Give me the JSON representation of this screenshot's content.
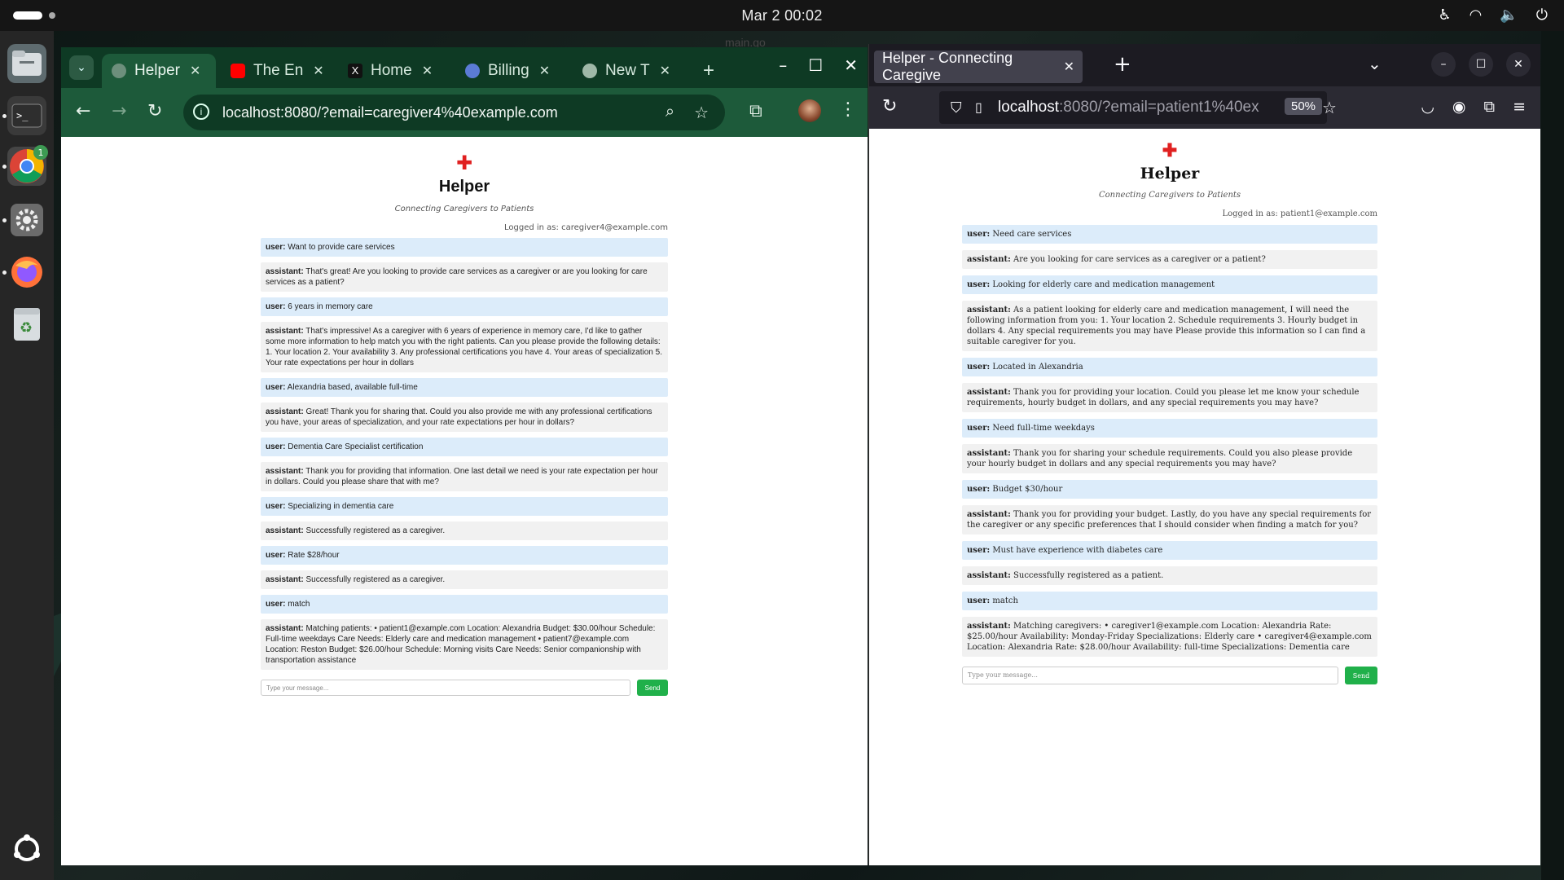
{
  "topbar": {
    "clock": "Mar 2  00:02"
  },
  "behind_window_title": "main.go",
  "chrome": {
    "tabs": [
      {
        "label": "Helper",
        "icon": "globe-icon",
        "active": true
      },
      {
        "label": "The En",
        "icon": "youtube-icon"
      },
      {
        "label": "Home",
        "icon": "x-icon"
      },
      {
        "label": "Billing",
        "icon": "openai-icon"
      },
      {
        "label": "New T",
        "icon": "chrome-icon"
      }
    ],
    "url": "localhost:8080/?email=caregiver4%40example.com"
  },
  "chrome_app": {
    "title": "Helper",
    "subtitle": "Connecting Caregivers to Patients",
    "login": "Logged in as: caregiver4@example.com",
    "messages": [
      {
        "role": "user",
        "label": "user:",
        "text": " Want to provide care services"
      },
      {
        "role": "assistant",
        "label": "assistant:",
        "text": " That's great! Are you looking to provide care services as a caregiver or are you looking for care services as a patient?"
      },
      {
        "role": "user",
        "label": "user:",
        "text": " 6 years in memory care"
      },
      {
        "role": "assistant",
        "label": "assistant:",
        "text": " That's impressive! As a caregiver with 6 years of experience in memory care, I'd like to gather some more information to help match you with the right patients. Can you please provide the following details: 1. Your location 2. Your availability 3. Any professional certifications you have 4. Your areas of specialization 5. Your rate expectations per hour in dollars"
      },
      {
        "role": "user",
        "label": "user:",
        "text": " Alexandria based, available full-time"
      },
      {
        "role": "assistant",
        "label": "assistant:",
        "text": " Great! Thank you for sharing that. Could you also provide me with any professional certifications you have, your areas of specialization, and your rate expectations per hour in dollars?"
      },
      {
        "role": "user",
        "label": "user:",
        "text": " Dementia Care Specialist certification"
      },
      {
        "role": "assistant",
        "label": "assistant:",
        "text": " Thank you for providing that information. One last detail we need is your rate expectation per hour in dollars. Could you please share that with me?"
      },
      {
        "role": "user",
        "label": "user:",
        "text": " Specializing in dementia care"
      },
      {
        "role": "assistant",
        "label": "assistant:",
        "text": " Successfully registered as a caregiver."
      },
      {
        "role": "user",
        "label": "user:",
        "text": " Rate $28/hour"
      },
      {
        "role": "assistant",
        "label": "assistant:",
        "text": " Successfully registered as a caregiver."
      },
      {
        "role": "user",
        "label": "user:",
        "text": " match"
      },
      {
        "role": "assistant",
        "label": "assistant:",
        "text": " Matching patients: • patient1@example.com Location: Alexandria Budget: $30.00/hour Schedule: Full-time weekdays Care Needs: Elderly care and medication management • patient7@example.com Location: Reston Budget: $26.00/hour Schedule: Morning visits Care Needs: Senior companionship with transportation assistance"
      }
    ],
    "input_placeholder": "Type your message...",
    "send_label": "Send"
  },
  "firefox": {
    "tab_title": "Helper - Connecting Caregive",
    "url_host": "localhost",
    "url_rest": ":8080/?email=patient1%40ex",
    "zoom": "50%"
  },
  "firefox_app": {
    "title": "Helper",
    "subtitle": "Connecting Caregivers to Patients",
    "login": "Logged in as: patient1@example.com",
    "messages": [
      {
        "role": "user",
        "label": "user:",
        "text": " Need care services"
      },
      {
        "role": "assistant",
        "label": "assistant:",
        "text": " Are you looking for care services as a caregiver or a patient?"
      },
      {
        "role": "user",
        "label": "user:",
        "text": " Looking for elderly care and medication management"
      },
      {
        "role": "assistant",
        "label": "assistant:",
        "text": " As a patient looking for elderly care and medication management, I will need the following information from you: 1. Your location 2. Schedule requirements 3. Hourly budget in dollars 4. Any special requirements you may have Please provide this information so I can find a suitable caregiver for you."
      },
      {
        "role": "user",
        "label": "user:",
        "text": " Located in Alexandria"
      },
      {
        "role": "assistant",
        "label": "assistant:",
        "text": " Thank you for providing your location. Could you please let me know your schedule requirements, hourly budget in dollars, and any special requirements you may have?"
      },
      {
        "role": "user",
        "label": "user:",
        "text": " Need full-time weekdays"
      },
      {
        "role": "assistant",
        "label": "assistant:",
        "text": " Thank you for sharing your schedule requirements. Could you also please provide your hourly budget in dollars and any special requirements you may have?"
      },
      {
        "role": "user",
        "label": "user:",
        "text": " Budget $30/hour"
      },
      {
        "role": "assistant",
        "label": "assistant:",
        "text": " Thank you for providing your budget. Lastly, do you have any special requirements for the caregiver or any specific preferences that I should consider when finding a match for you?"
      },
      {
        "role": "user",
        "label": "user:",
        "text": " Must have experience with diabetes care"
      },
      {
        "role": "assistant",
        "label": "assistant:",
        "text": " Successfully registered as a patient."
      },
      {
        "role": "user",
        "label": "user:",
        "text": " match"
      },
      {
        "role": "assistant",
        "label": "assistant:",
        "text": " Matching caregivers: • caregiver1@example.com Location: Alexandria Rate: $25.00/hour Availability: Monday-Friday Specializations: Elderly care • caregiver4@example.com Location: Alexandria Rate: $28.00/hour Availability: full-time Specializations: Dementia care"
      }
    ],
    "input_placeholder": "Type your message...",
    "send_label": "Send"
  },
  "dock": {
    "items": [
      {
        "name": "files-icon"
      },
      {
        "name": "terminal-icon"
      },
      {
        "name": "chrome-icon",
        "badge": "1"
      },
      {
        "name": "settings-icon"
      },
      {
        "name": "firefox-icon"
      },
      {
        "name": "trash-icon"
      },
      {
        "name": "ubuntu-icon"
      }
    ]
  },
  "colors": {
    "user_bubble": "#dcecfa",
    "assistant_bubble": "#f1f1f1",
    "send_button": "#20b04a",
    "chrome_frame": "#1d5a3a",
    "firefox_frame": "#2b2a33"
  }
}
